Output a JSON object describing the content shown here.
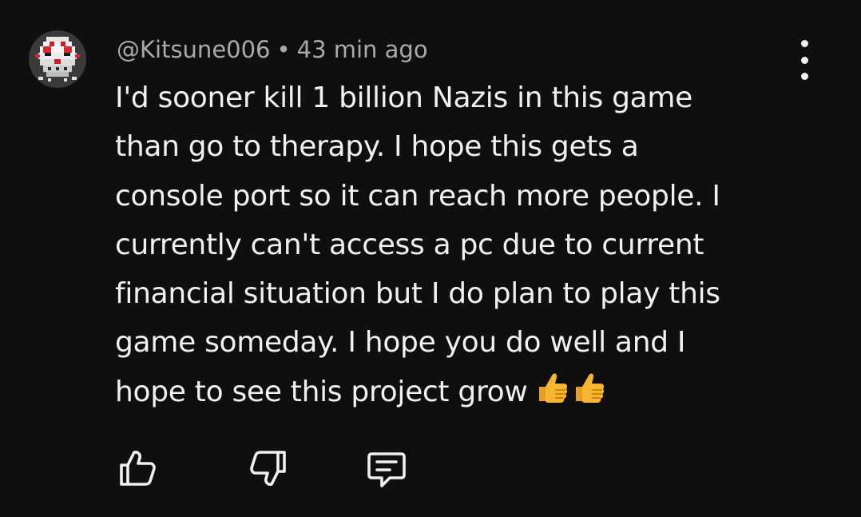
{
  "comment": {
    "author": "@Kitsune006",
    "separator": "•",
    "time": "43 min ago",
    "text_lines": [
      "I'd sooner kill 1 billion Nazis in this game",
      "than go to therapy. I hope this gets a",
      "console port so it can reach more people. I",
      "currently can't access a pc due to current",
      "financial situation but I do plan to play this",
      "game someday. I hope you do well and I",
      "hope to see this project grow"
    ],
    "trailing_emoji": [
      "thumbs-up-emoji",
      "thumbs-up-emoji"
    ],
    "avatar": "pixel-art-mask-avatar"
  },
  "actions": {
    "like_icon": "thumbs-up-outline-icon",
    "dislike_icon": "thumbs-down-outline-icon",
    "reply_icon": "comment-reply-icon",
    "more_icon": "vertical-ellipsis-icon"
  },
  "colors": {
    "background": "#0f0f0f",
    "text_primary": "#f1f1f1",
    "text_secondary": "#aaaaaa",
    "emoji_yellow": "#f7b632"
  }
}
